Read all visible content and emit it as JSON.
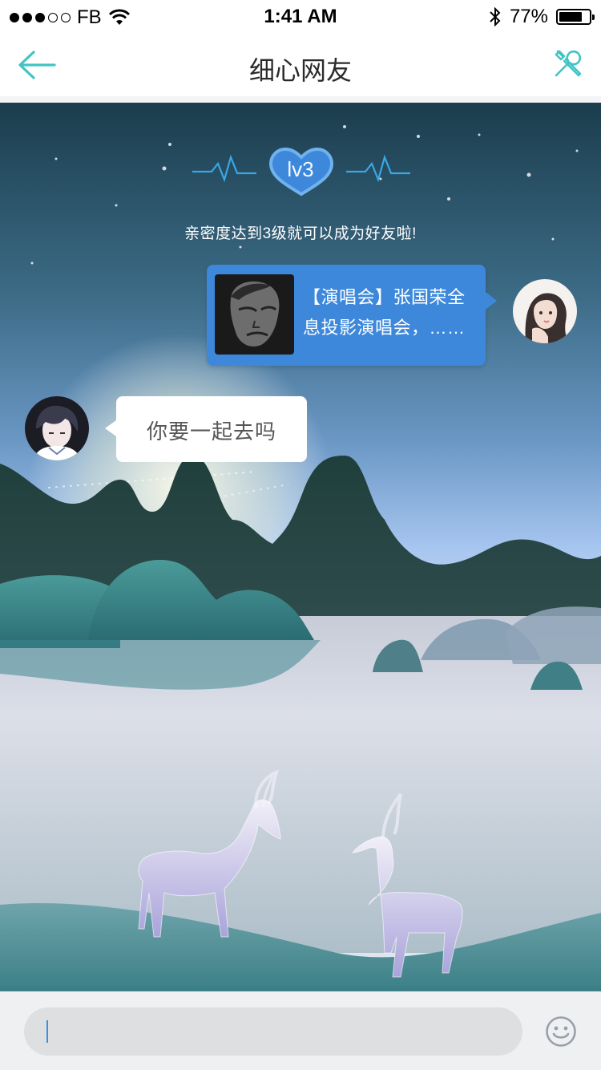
{
  "status_bar": {
    "carrier": "FB",
    "time": "1:41 AM",
    "battery": "77%",
    "battery_level": 0.77
  },
  "nav": {
    "title": "细心网友"
  },
  "intimacy": {
    "level_label": "lv3",
    "hint": "亲密度达到3级就可以成为好友啦!"
  },
  "messages": {
    "outgoing_share": {
      "text": "【演唱会】张国荣全息投影演唱会，……"
    },
    "incoming_text": {
      "text": "你要一起去吗"
    }
  },
  "input": {
    "value": "",
    "placeholder": ""
  },
  "icons": {
    "back": "back-arrow-icon",
    "tools": "tools-icon",
    "emoji": "emoji-icon",
    "bluetooth": "bluetooth-icon",
    "wifi": "wifi-icon"
  },
  "colors": {
    "accent": "#3d88db",
    "nav_icon": "#41c4c4"
  }
}
